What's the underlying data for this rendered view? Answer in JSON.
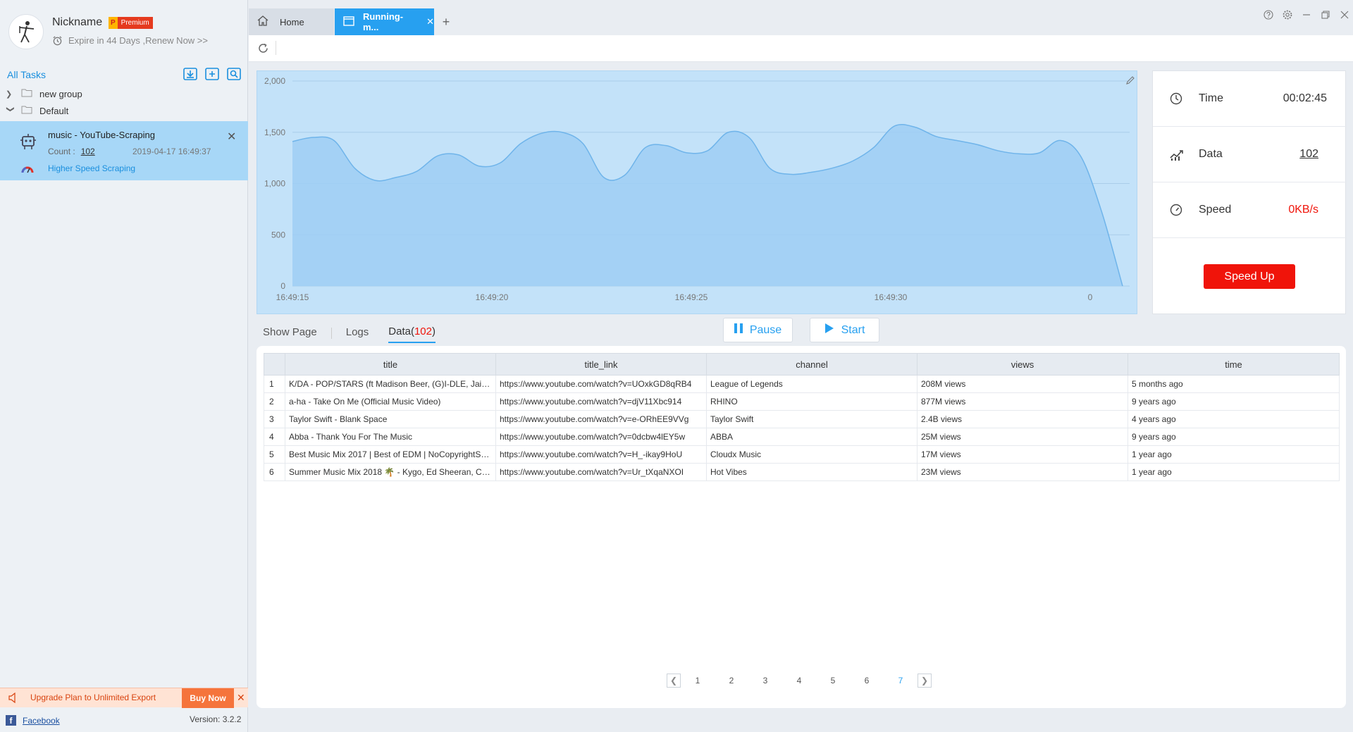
{
  "user": {
    "nickname": "Nickname",
    "badge_p": "P",
    "badge_label": "Premium",
    "expire_text": "Expire in 44 Days ,Renew Now >>"
  },
  "sidebar": {
    "all_tasks": "All Tasks",
    "groups": [
      {
        "label": "new group",
        "expanded": false
      },
      {
        "label": "Default",
        "expanded": true
      }
    ],
    "task": {
      "name": "music - YouTube-Scraping",
      "count_label": "Count :",
      "count": "102",
      "date": "2019-04-17 16:49:37",
      "mode": "Higher Speed Scraping"
    },
    "upgrade_text": "Upgrade Plan to Unlimited Export",
    "buy_now": "Buy Now",
    "facebook": "Facebook",
    "version": "Version: 3.2.2"
  },
  "tabs": {
    "home": "Home",
    "running": "Running-m...",
    "add": "+"
  },
  "chart_data": {
    "type": "area",
    "x_ticks": [
      "16:49:15",
      "16:49:20",
      "16:49:25",
      "16:49:30",
      "0"
    ],
    "y_ticks": [
      "0",
      "500",
      "1,000",
      "1,500",
      "2,000"
    ],
    "ylim": [
      0,
      2000
    ],
    "grid": true,
    "values": [
      1410,
      1450,
      1420,
      1150,
      1030,
      1060,
      1120,
      1270,
      1280,
      1170,
      1200,
      1390,
      1490,
      1500,
      1390,
      1060,
      1080,
      1350,
      1370,
      1300,
      1320,
      1500,
      1450,
      1150,
      1090,
      1110,
      1150,
      1220,
      1350,
      1560,
      1550,
      1460,
      1420,
      1380,
      1320,
      1290,
      1300,
      1420,
      1260,
      720,
      0
    ]
  },
  "stats": {
    "time_label": "Time",
    "time_value": "00:02:45",
    "data_label": "Data",
    "data_value": "102",
    "speed_label": "Speed",
    "speed_value": "0KB/s",
    "speed_up": "Speed Up"
  },
  "subtabs": {
    "show_page": "Show Page",
    "logs": "Logs",
    "data": "Data(",
    "data_count": "102",
    "data_close": ")"
  },
  "controls": {
    "pause": "Pause",
    "start": "Start"
  },
  "table": {
    "columns": [
      "",
      "title",
      "title_link",
      "channel",
      "views",
      "time"
    ],
    "rows": [
      [
        "1",
        "K/DA - POP/STARS (ft Madison Beer, (G)I-DLE, Jaira...",
        "https://www.youtube.com/watch?v=UOxkGD8qRB4",
        "League of Legends",
        "208M views",
        "5 months ago"
      ],
      [
        "2",
        "a-ha - Take On Me (Official Music Video)",
        "https://www.youtube.com/watch?v=djV11Xbc914",
        "RHINO",
        "877M views",
        "9 years ago"
      ],
      [
        "3",
        "Taylor Swift - Blank Space",
        "https://www.youtube.com/watch?v=e-ORhEE9VVg",
        "Taylor Swift",
        "2.4B views",
        "4 years ago"
      ],
      [
        "4",
        "Abba - Thank You For The Music",
        "https://www.youtube.com/watch?v=0dcbw4lEY5w",
        "ABBA",
        "25M views",
        "9 years ago"
      ],
      [
        "5",
        "Best Music Mix 2017 | Best of EDM | NoCopyrightSo...",
        "https://www.youtube.com/watch?v=H_-ikay9HoU",
        "Cloudx Music",
        "17M views",
        "1 year ago"
      ],
      [
        "6",
        "Summer Music Mix 2018 🌴 - Kygo, Ed Sheeran, Co...",
        "https://www.youtube.com/watch?v=Ur_tXqaNXOI",
        "Hot Vibes",
        "23M views",
        "1 year ago"
      ]
    ]
  },
  "pager": {
    "pages": [
      "1",
      "2",
      "3",
      "4",
      "5",
      "6",
      "7"
    ],
    "active": "7"
  }
}
